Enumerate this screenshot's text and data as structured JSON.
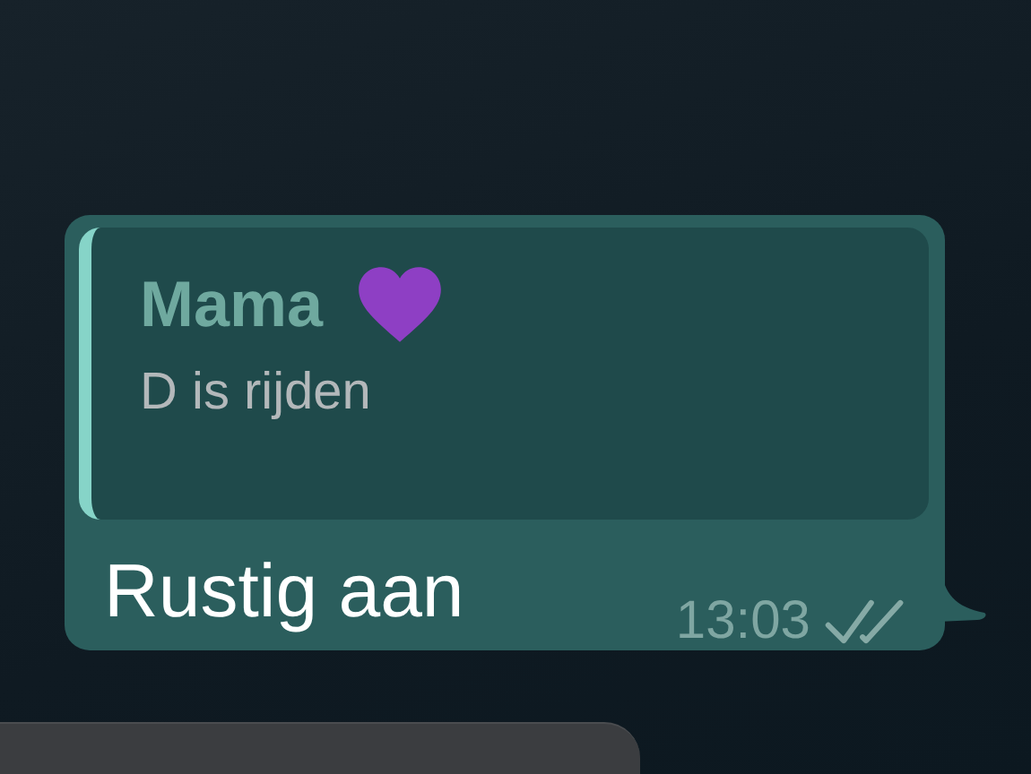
{
  "message": {
    "quote": {
      "sender": "Mama",
      "text": "D is rijden"
    },
    "text": "Rustig aan",
    "time": "13:03",
    "read": false
  }
}
